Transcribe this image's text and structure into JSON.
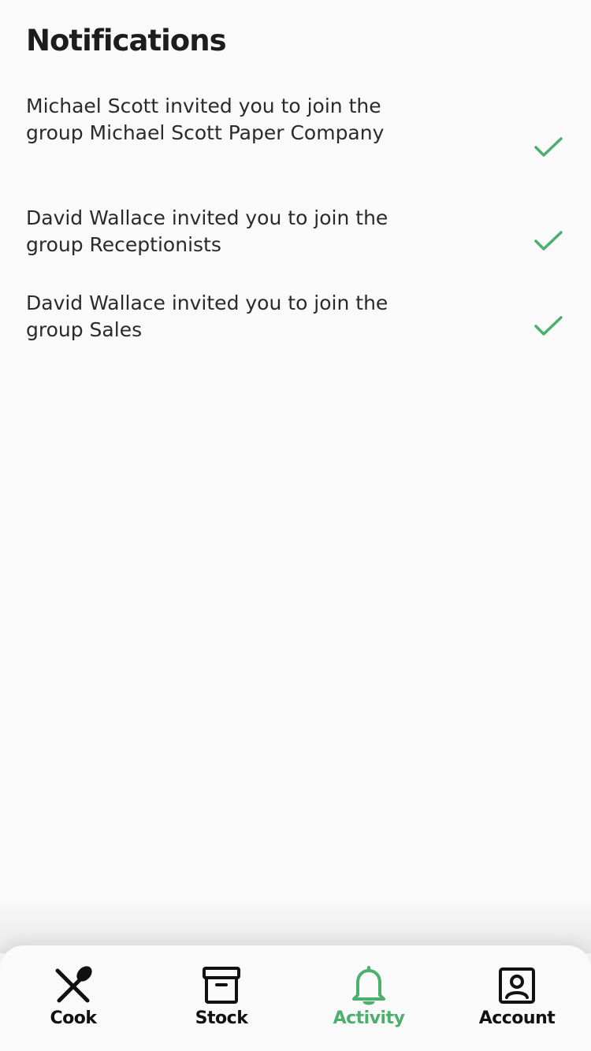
{
  "header": {
    "title": "Notifications"
  },
  "notifications": [
    {
      "text": "Michael Scott invited you to join the group Michael Scott Paper Company",
      "action": "accept"
    },
    {
      "text": "David Wallace invited you to join the group Receptionists",
      "action": "accept"
    },
    {
      "text": "David Wallace invited you to join the group Sales",
      "action": "accept"
    }
  ],
  "bottom_nav": {
    "items": [
      {
        "label": "Cook",
        "icon": "spoon-knife-icon",
        "active": false
      },
      {
        "label": "Stock",
        "icon": "archive-box-icon",
        "active": false
      },
      {
        "label": "Activity",
        "icon": "bell-icon",
        "active": true
      },
      {
        "label": "Account",
        "icon": "account-portrait-icon",
        "active": false
      }
    ]
  },
  "colors": {
    "accent": "#4caf6e",
    "background": "#fafafa",
    "text": "#2a2a2a"
  }
}
